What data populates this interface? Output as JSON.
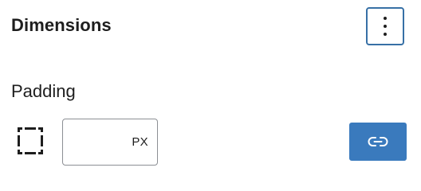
{
  "panel": {
    "title": "Dimensions",
    "options_icon": "more-vertical-icon"
  },
  "padding": {
    "label": "Padding",
    "sides_icon": "box-sides-icon",
    "input_value": "",
    "unit": "PX",
    "link_icon": "link-sides-icon",
    "link_button_color": "#3a7abd"
  },
  "colors": {
    "accent": "#3a7abd",
    "focus_border": "#3770a6",
    "text": "#1e1e1e",
    "input_border": "#8c8f94"
  }
}
